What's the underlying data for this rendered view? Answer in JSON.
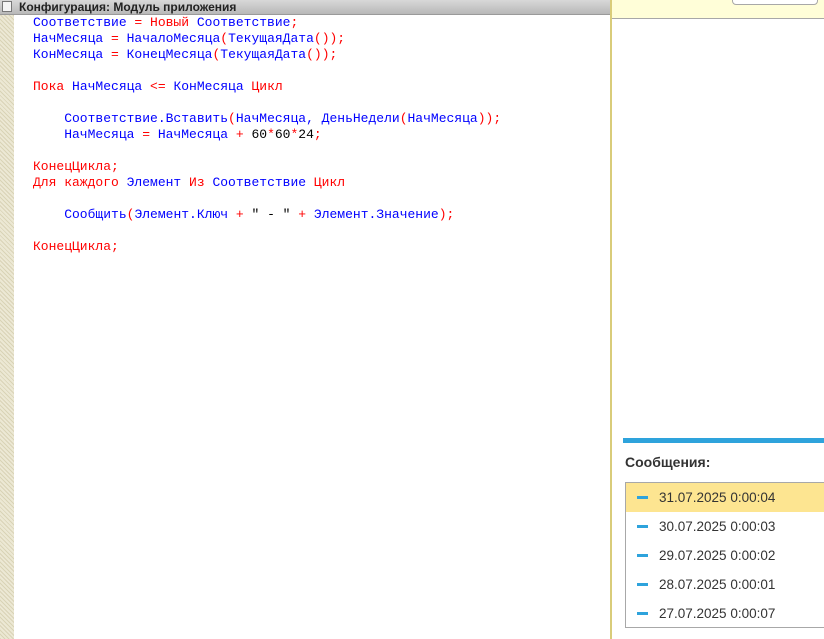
{
  "editor": {
    "title": "Конфигурация: Модуль приложения",
    "lines": [
      [
        {
          "t": "Соответствие",
          "k": "id"
        },
        {
          "t": " = ",
          "k": "op"
        },
        {
          "t": "Новый",
          "k": "kw"
        },
        {
          "t": " Соответствие",
          "k": "id"
        },
        {
          "t": ";",
          "k": "op"
        }
      ],
      [
        {
          "t": "НачМесяца",
          "k": "id"
        },
        {
          "t": " = ",
          "k": "op"
        },
        {
          "t": "НачалоМесяца",
          "k": "id"
        },
        {
          "t": "(",
          "k": "op"
        },
        {
          "t": "ТекущаяДата",
          "k": "id"
        },
        {
          "t": "());",
          "k": "op"
        }
      ],
      [
        {
          "t": "КонМесяца",
          "k": "id"
        },
        {
          "t": " = ",
          "k": "op"
        },
        {
          "t": "КонецМесяца",
          "k": "id"
        },
        {
          "t": "(",
          "k": "op"
        },
        {
          "t": "ТекущаяДата",
          "k": "id"
        },
        {
          "t": "());",
          "k": "op"
        }
      ],
      [],
      [
        {
          "t": "Пока",
          "k": "kw"
        },
        {
          "t": " НачМесяца",
          "k": "id"
        },
        {
          "t": " <= ",
          "k": "op"
        },
        {
          "t": "КонМесяца",
          "k": "id"
        },
        {
          "t": " Цикл",
          "k": "kw"
        }
      ],
      [],
      [
        {
          "t": "    Соответствие.Вставить",
          "k": "id"
        },
        {
          "t": "(",
          "k": "op"
        },
        {
          "t": "НачМесяца, ДеньНедели",
          "k": "id"
        },
        {
          "t": "(",
          "k": "op"
        },
        {
          "t": "НачМесяца",
          "k": "id"
        },
        {
          "t": "));",
          "k": "op"
        }
      ],
      [
        {
          "t": "    НачМесяца",
          "k": "id"
        },
        {
          "t": " = ",
          "k": "op"
        },
        {
          "t": "НачМесяца",
          "k": "id"
        },
        {
          "t": " + ",
          "k": "op"
        },
        {
          "t": "60",
          "k": "num"
        },
        {
          "t": "*",
          "k": "op"
        },
        {
          "t": "60",
          "k": "num"
        },
        {
          "t": "*",
          "k": "op"
        },
        {
          "t": "24",
          "k": "num"
        },
        {
          "t": ";",
          "k": "op"
        }
      ],
      [],
      [
        {
          "t": "КонецЦикла;",
          "k": "kw"
        }
      ],
      [
        {
          "t": "Для каждого",
          "k": "kw"
        },
        {
          "t": " Элемент",
          "k": "id"
        },
        {
          "t": " Из",
          "k": "kw"
        },
        {
          "t": " Соответствие",
          "k": "id"
        },
        {
          "t": " Цикл",
          "k": "kw"
        }
      ],
      [],
      [
        {
          "t": "    Сообщить",
          "k": "id"
        },
        {
          "t": "(",
          "k": "op"
        },
        {
          "t": "Элемент.Ключ",
          "k": "id"
        },
        {
          "t": " + ",
          "k": "op"
        },
        {
          "t": "\" - \"",
          "k": "str"
        },
        {
          "t": " + ",
          "k": "op"
        },
        {
          "t": "Элемент.Значение",
          "k": "id"
        },
        {
          "t": ");",
          "k": "op"
        }
      ],
      [],
      [
        {
          "t": "КонецЦикла;",
          "k": "kw"
        }
      ]
    ]
  },
  "messages": {
    "title": "Сообщения:",
    "items": [
      {
        "text": "31.07.2025 0:00:04",
        "selected": true
      },
      {
        "text": "30.07.2025 0:00:03",
        "selected": false
      },
      {
        "text": "29.07.2025 0:00:02",
        "selected": false
      },
      {
        "text": "28.07.2025 0:00:01",
        "selected": false
      },
      {
        "text": "27.07.2025 0:00:07",
        "selected": false
      }
    ]
  },
  "colors": {
    "keyword": "#ff0000",
    "identifier": "#0000ff",
    "accent": "#2ea3dc",
    "selection": "#fde591"
  }
}
